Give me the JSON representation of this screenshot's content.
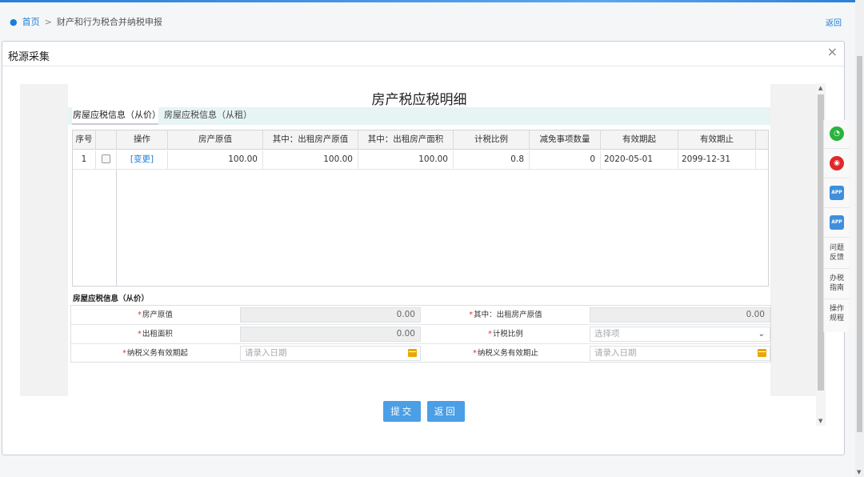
{
  "breadcrumb": {
    "home": "首页",
    "separator": ">",
    "current": "财产和行为税合并纳税申报"
  },
  "back_link": "返回",
  "dialog": {
    "title": "税源采集",
    "close": "×"
  },
  "form": {
    "title": "房产税应税明细",
    "tabs": [
      {
        "label": "房屋应税信息（从价）"
      },
      {
        "label": "房屋应税信息（从租）"
      }
    ],
    "grid": {
      "headers": [
        "序号",
        "",
        "操作",
        "房产原值",
        "其中：出租房产原值",
        "其中：出租房产面积",
        "计税比例",
        "减免事项数量",
        "有效期起",
        "有效期止"
      ],
      "rows": [
        {
          "index": "1",
          "action": "[变更]",
          "original_value": "100.00",
          "rental_original_value": "100.00",
          "rental_area": "100.00",
          "tax_ratio": "0.8",
          "exemption_count": "0",
          "valid_from": "2020-05-01",
          "valid_to": "2099-12-31"
        }
      ]
    },
    "section_title": "房屋应税信息（从价）",
    "fields": {
      "original_value": {
        "label": "房产原值",
        "value": "0.00"
      },
      "rental_original_value": {
        "label": "其中：出租房产原值",
        "value": "0.00"
      },
      "rental_area": {
        "label": "出租面积",
        "value": "0.00"
      },
      "tax_ratio": {
        "label": "计税比例",
        "placeholder": "选择项"
      },
      "duty_start": {
        "label": "纳税义务有效期起",
        "placeholder": "请录入日期"
      },
      "duty_end": {
        "label": "纳税义务有效期止",
        "placeholder": "请录入日期"
      }
    }
  },
  "buttons": {
    "submit": "提交",
    "back": "返回"
  },
  "side_tools": {
    "wechat": "微信",
    "weibo": "微博",
    "app1": "APP",
    "app2": "APP",
    "feedback": "问题反馈",
    "guide": "办税指南",
    "manual": "操作规程"
  },
  "colors": {
    "accent": "#1b7ed8",
    "button": "#4a9fe6",
    "required": "#dd3333",
    "tab_bg": "#e6f4f3"
  }
}
